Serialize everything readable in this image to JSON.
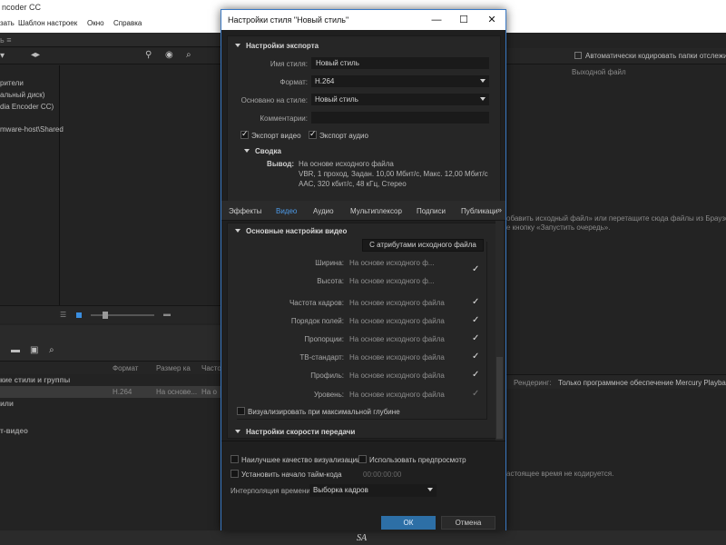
{
  "app": {
    "title": "ncoder CC",
    "menu": [
      "зать",
      "Шаблон настроек",
      "Окно",
      "Справка"
    ],
    "left_panel_rows": [
      "рители",
      "альный диск)",
      "dia Encoder CC)",
      "mware-host\\Shared"
    ],
    "preset_columns": [
      "Формат",
      "Размер ка",
      "Часто"
    ],
    "preset_groups": [
      "кие стили и группы",
      "или",
      "т-видео"
    ],
    "preset_row": {
      "format": "H.264",
      "size": "На основе...",
      "rate": "На о"
    },
    "queue_auto_encode": "Автоматически кодировать папки отслежива",
    "queue_output_col": "Выходной файл",
    "queue_hint_1": "обавить исходный файл» или перетащите сюда файлы из Браузера ме",
    "queue_hint_2": "е кнопку «Запустить очередь».",
    "rendering_label": "Рендеринг:",
    "rendering_value": "Только программное обеспечение Mercury Playback",
    "realtime_note": "астоящее время не кодируется.",
    "watermark": "SA"
  },
  "dialog": {
    "title": "Настройки стиля \"Новый стиль\"",
    "export_settings": {
      "title": "Настройки экспорта",
      "style_name_label": "Имя стиля:",
      "style_name_value": "Новый стиль",
      "format_label": "Формат:",
      "format_value": "H.264",
      "based_on_label": "Основано на стиле:",
      "based_on_value": "Новый стиль",
      "comments_label": "Комментарии:",
      "comments_value": "",
      "export_video_label": "Экспорт видео",
      "export_audio_label": "Экспорт аудио",
      "summary_title": "Сводка",
      "output_label": "Вывод:",
      "output_line1": "На основе исходного файла",
      "output_line2": "VBR, 1 проход, Задан. 10,00 Мбит/с, Макс. 12,00 Мбит/с",
      "output_line3": "AAC, 320 кбит/с, 48 кГц, Стерео"
    },
    "tabs": [
      "Эффекты",
      "Видео",
      "Аудио",
      "Мультиплексор",
      "Подписи",
      "Публикаци"
    ],
    "tabs_more": "»",
    "video": {
      "section_title": "Основные настройки видео",
      "match_source_button": "С атрибутами исходного файла",
      "rows": [
        {
          "label": "Ширина:",
          "value": "На основе исходного ф..."
        },
        {
          "label": "Высота:",
          "value": "На основе исходного ф..."
        },
        {
          "label": "Частота кадров:",
          "value": "На основе исходного файла"
        },
        {
          "label": "Порядок полей:",
          "value": "На основе исходного файла"
        },
        {
          "label": "Пропорции:",
          "value": "На основе исходного файла"
        },
        {
          "label": "ТВ-стандарт:",
          "value": "На основе исходного файла"
        },
        {
          "label": "Профиль:",
          "value": "На основе исходного файла"
        },
        {
          "label": "Уровень:",
          "value": "На основе исходного файла"
        }
      ],
      "max_depth_label": "Визуализировать при максимальной глубине",
      "bitrate_title": "Настройки скорости передачи"
    },
    "bottom": {
      "max_quality_label": "Наилучшее качество визуализации",
      "use_preview_label": "Использовать предпросмотр",
      "set_timecode_label": "Установить начало тайм-кода",
      "timecode_value": "00:00:00:00",
      "interpolation_label": "Интерполяция времени:",
      "interpolation_value": "Выборка кадров",
      "ok_label": "ОК",
      "cancel_label": "Отмена"
    }
  }
}
